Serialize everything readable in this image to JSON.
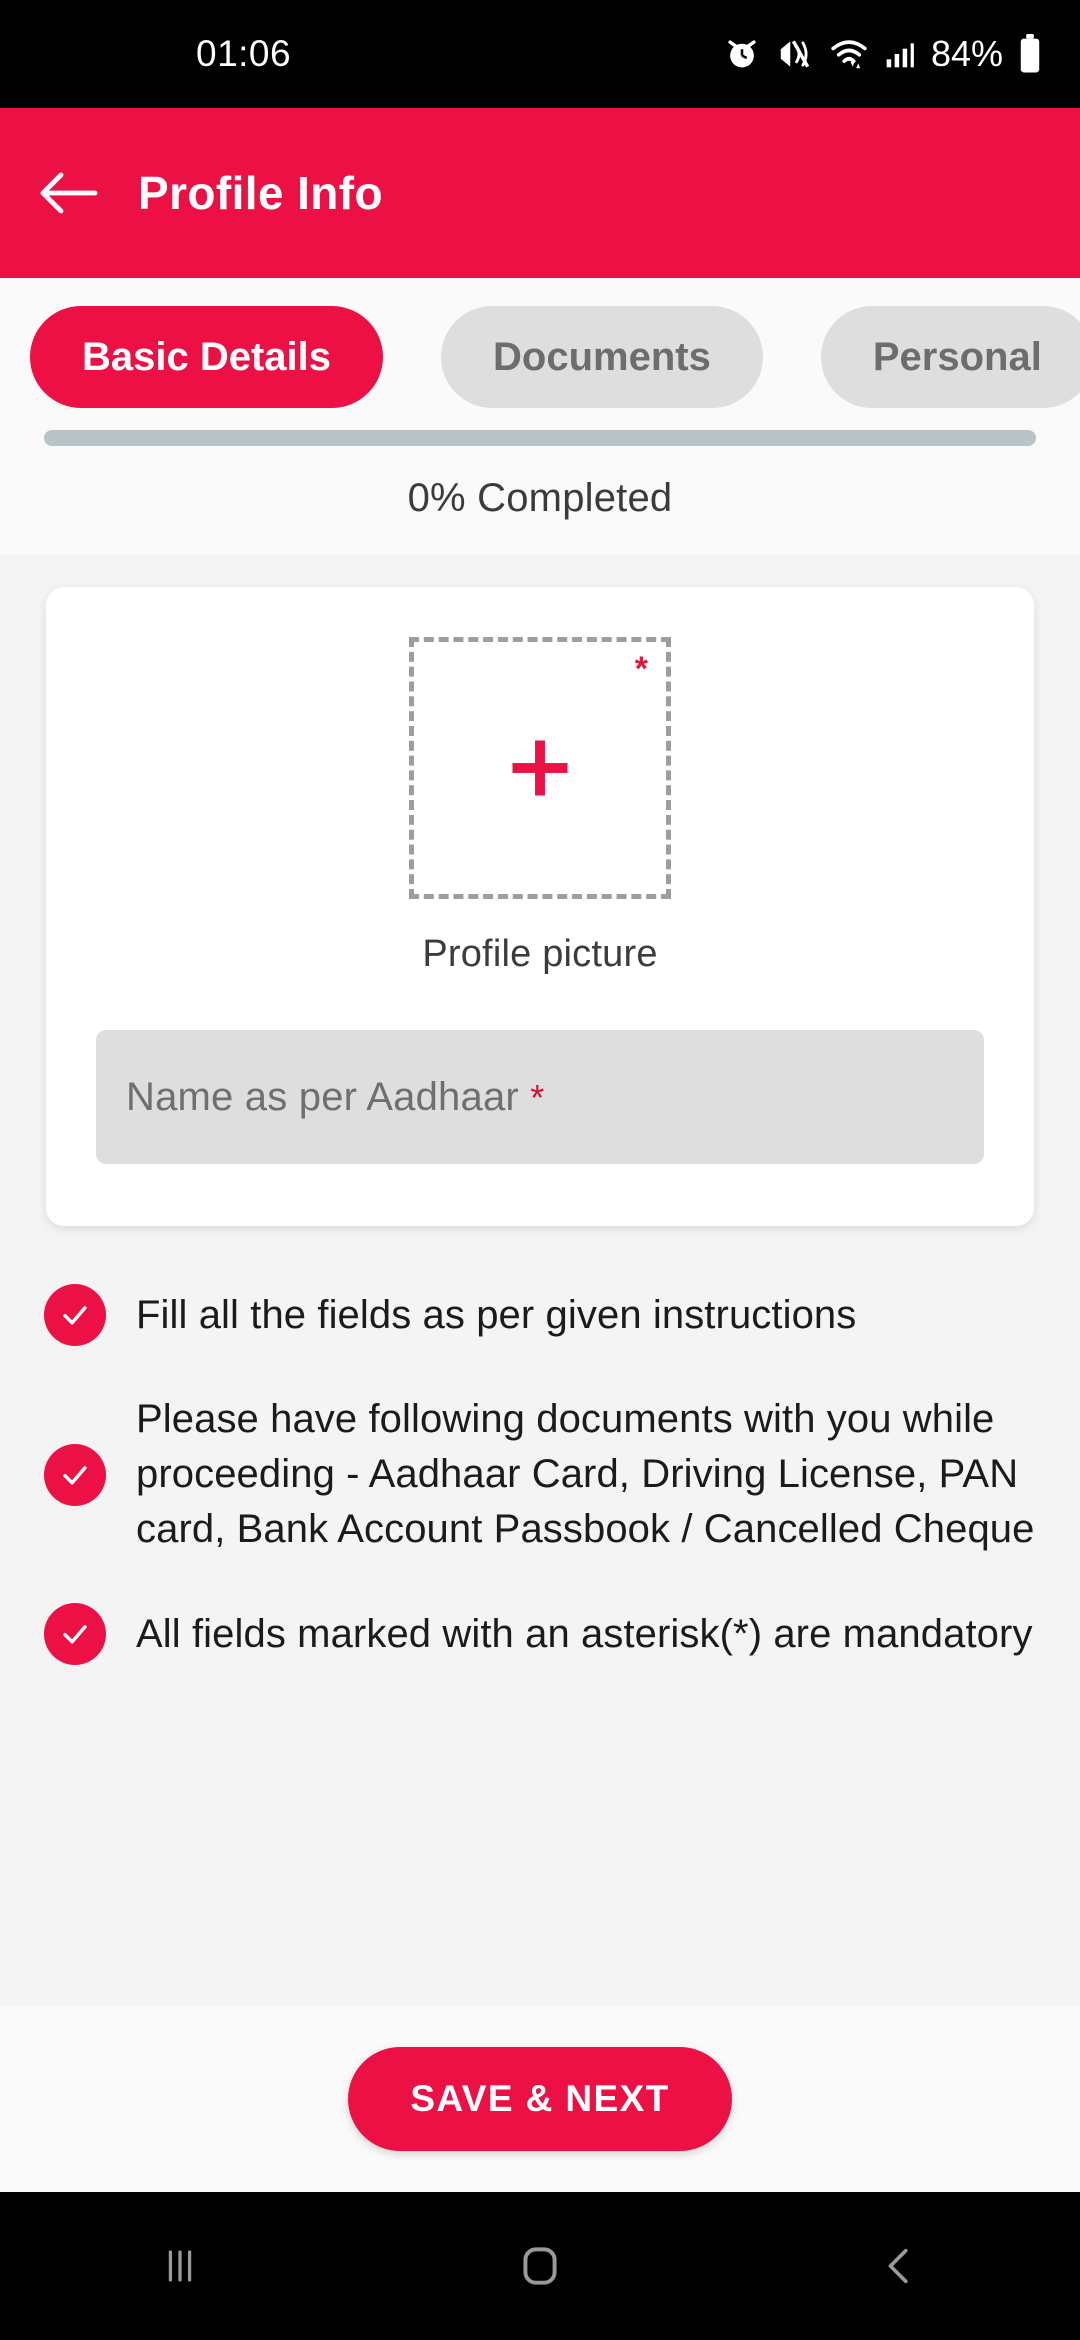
{
  "status_bar": {
    "time": "01:06",
    "battery_percent": "84%",
    "icons": [
      "alarm-icon",
      "vibrate-icon",
      "wifi-icon",
      "signal-icon",
      "battery-icon"
    ]
  },
  "app_bar": {
    "back_icon": "back-arrow-icon",
    "title": "Profile Info"
  },
  "tabs": [
    {
      "label": "Basic Details",
      "active": true
    },
    {
      "label": "Documents",
      "active": false
    },
    {
      "label": "Personal",
      "active": false
    }
  ],
  "progress": {
    "percent": 0,
    "label": "0% Completed",
    "track_color": "#b7c3c7",
    "fill_color": "#ED1045"
  },
  "form_card": {
    "photo_upload": {
      "icon": "plus-icon",
      "required_marker": "*",
      "label": "Profile picture"
    },
    "name_field": {
      "placeholder": "Name as per Aadhaar",
      "required_marker": "*",
      "value": ""
    }
  },
  "instructions": [
    {
      "icon": "check-circle-icon",
      "text": "Fill all the fields as per given instructions"
    },
    {
      "icon": "check-circle-icon",
      "text": "Please have following documents with you while proceeding - Aadhaar Card, Driving License, PAN card, Bank Account Passbook / Cancelled Cheque"
    },
    {
      "icon": "check-circle-icon",
      "text": "All fields marked with an asterisk(*) are mandatory"
    }
  ],
  "footer": {
    "save_label": "SAVE & NEXT"
  },
  "nav_bar": {
    "recents_icon": "recents-icon",
    "home_icon": "home-icon",
    "back_icon": "back-icon"
  },
  "theme": {
    "accent": "#ED1045",
    "accent_dark": "#d8102f",
    "page_bg": "#f4f4f4",
    "card_bg": "#ffffff",
    "tab_inactive_bg": "#dedede",
    "field_bg": "#dedede"
  }
}
